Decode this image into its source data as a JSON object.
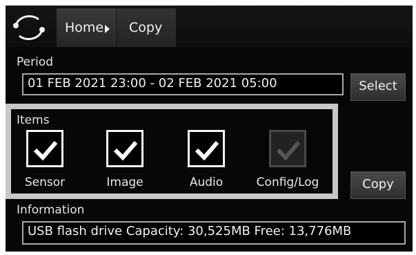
{
  "breadcrumb": {
    "home": "Home",
    "current": "Copy"
  },
  "period": {
    "label": "Period",
    "value": "01 FEB 2021 23:00 - 02 FEB 2021 05:00",
    "select_label": "Select"
  },
  "items": {
    "label": "Items",
    "options": [
      {
        "label": "Sensor",
        "checked": true,
        "enabled": true
      },
      {
        "label": "Image",
        "checked": true,
        "enabled": true
      },
      {
        "label": "Audio",
        "checked": true,
        "enabled": true
      },
      {
        "label": "Config/Log",
        "checked": true,
        "enabled": false
      }
    ],
    "copy_label": "Copy"
  },
  "information": {
    "label": "Information",
    "value": "USB flash drive  Capacity: 30,525MB  Free: 13,776MB"
  },
  "colors": {
    "background": "#070707",
    "highlight_border": "#c8c8c8",
    "text": "#f0f0f0"
  },
  "icons": {
    "logo": "cycle-logo-icon",
    "home_arrow": "triangle-right-icon",
    "check": "checkmark-icon"
  }
}
